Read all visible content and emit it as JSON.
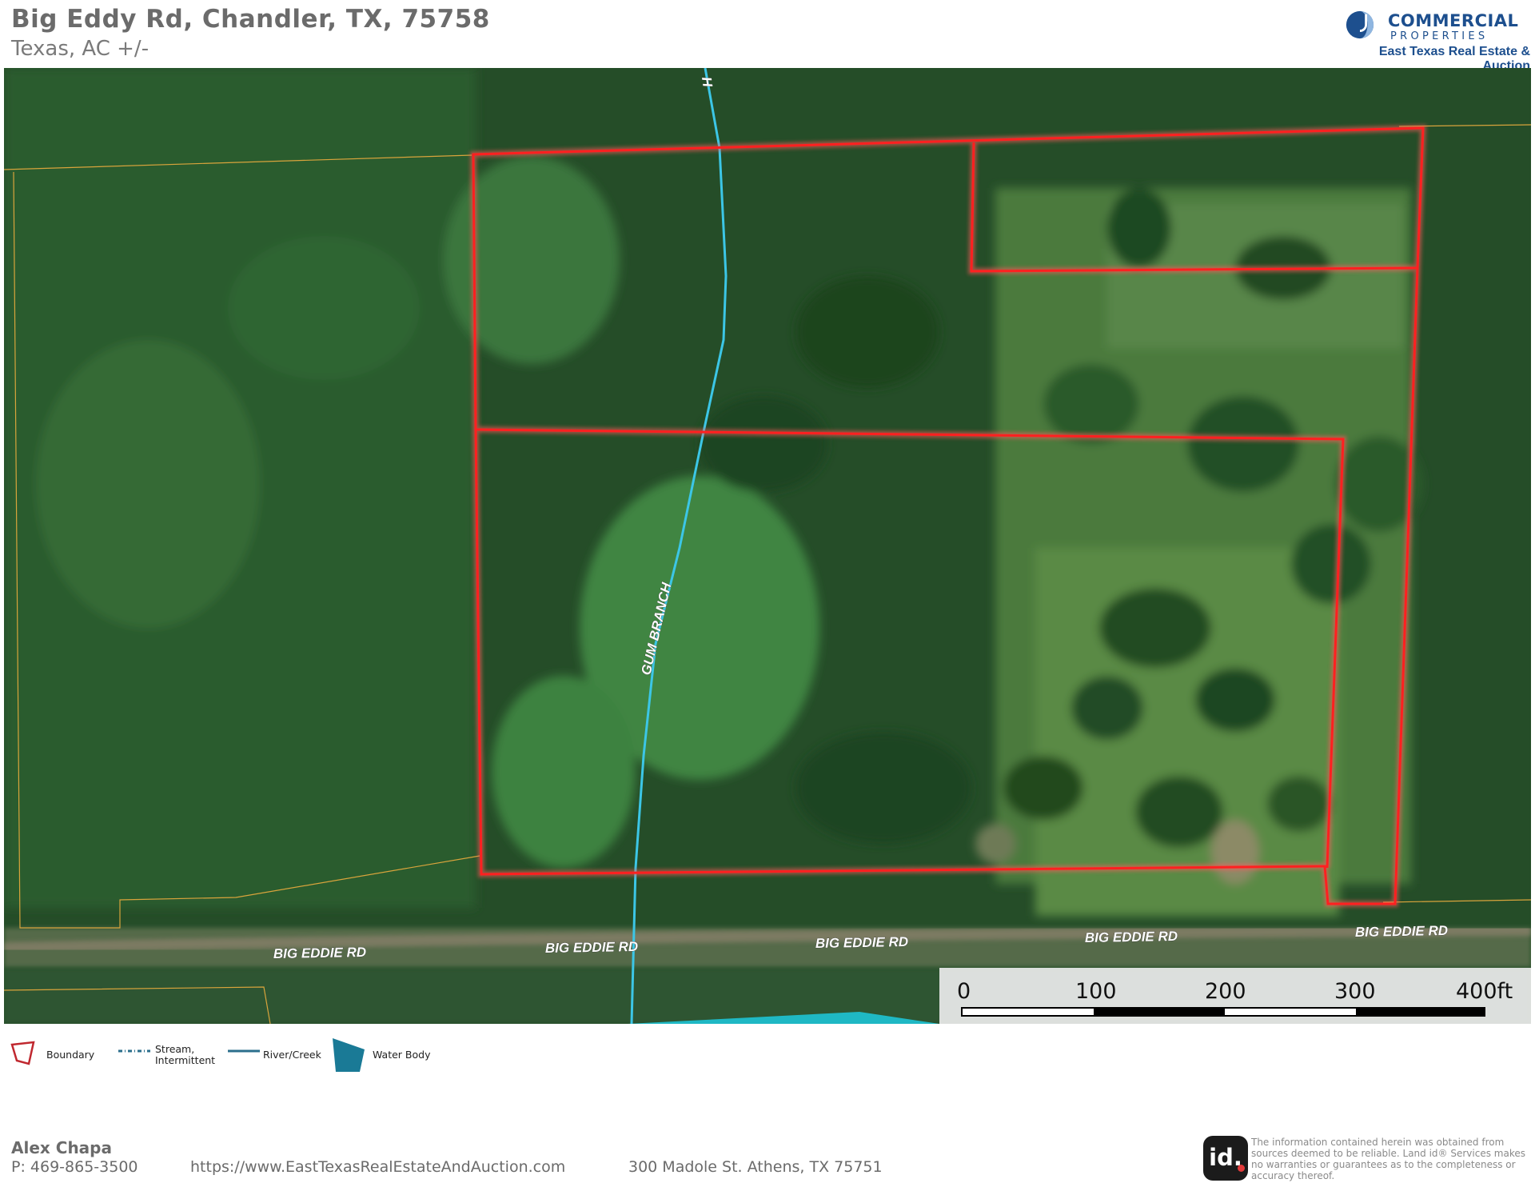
{
  "header": {
    "title": "Big Eddy Rd, Chandler, TX, 75758",
    "subtitle": "Texas,  AC +/-"
  },
  "brand": {
    "name": "COMMERCIAL",
    "name_sub": "PROPERTIES",
    "tagline": "East Texas Real Estate & Auction",
    "color": "#1d4f8e"
  },
  "map": {
    "stream_name": "GUM BRANCH",
    "stream_top_label": "H",
    "road_labels": [
      "BIG EDDIE RD",
      "BIG EDDIE RD",
      "BIG EDDIE RD",
      "BIG EDDIE RD",
      "BIG EDDIE RD"
    ],
    "boundary_color": "#ff2a2a",
    "stream_color": "#3cc6e6",
    "parcel_line_color": "#d9a43c",
    "water_body_color": "#1fb8c4"
  },
  "scale": {
    "ticks": [
      "0",
      "100",
      "200",
      "300",
      "400ft"
    ]
  },
  "legend": {
    "boundary": "Boundary",
    "stream": "Stream, Intermittent",
    "stream_line1": "Stream,",
    "stream_line2": "Intermittent",
    "river": "River/Creek",
    "water": "Water Body"
  },
  "footer": {
    "name": "Alex Chapa",
    "phone": "P: 469-865-3500",
    "url": "https://www.EastTexasRealEstateAndAuction.com",
    "address": "300 Madole St. Athens, TX 75751",
    "id_logo": "id.",
    "disclaimer": "The information contained herein was obtained from sources deemed to be reliable.  Land id® Services makes no warranties or guarantees as to the completeness or accuracy thereof."
  }
}
